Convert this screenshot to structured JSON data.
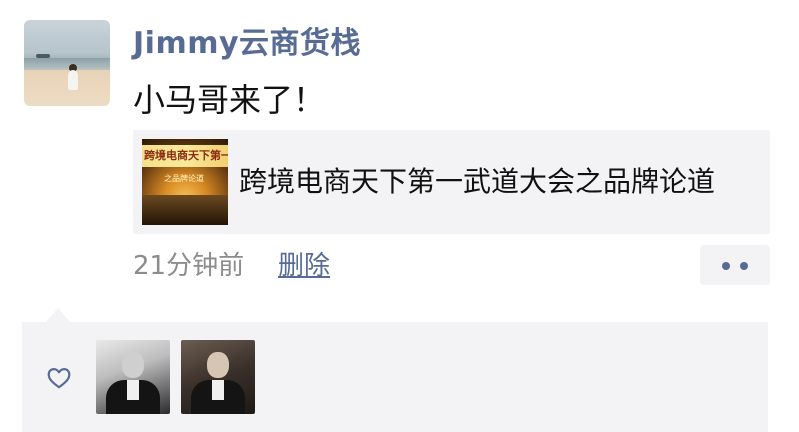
{
  "post": {
    "author_name": "Jimmy云商货栈",
    "text": "小马哥来了！",
    "timestamp": "21分钟前",
    "delete_label": "删除"
  },
  "link_card": {
    "title": "跨境电商天下第一武道大会之品牌论道",
    "thumbnail_banner_text": "跨境电商天下第一武道",
    "thumbnail_sub_text": "之品牌论道"
  },
  "likes": {
    "icon": "heart-outline-icon",
    "count": 2
  },
  "colors": {
    "name_link": "#576b95",
    "panel_bg": "#f3f3f5",
    "meta_text": "#8c8c8c"
  }
}
